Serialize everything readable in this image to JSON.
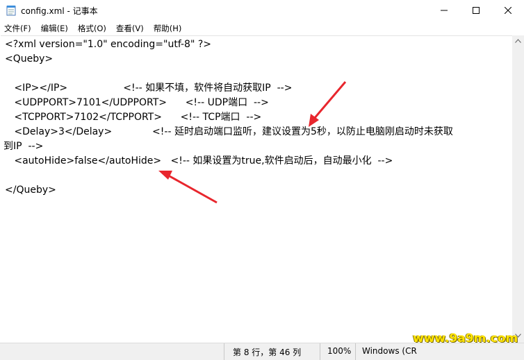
{
  "window": {
    "title": "config.xml - 记事本",
    "minimize_glyph": "minimize",
    "maximize_glyph": "maximize",
    "close_glyph": "close"
  },
  "menu": [
    "文件(F)",
    "编辑(E)",
    "格式(O)",
    "查看(V)",
    "帮助(H)"
  ],
  "editor": {
    "lines": [
      "<?xml version=\"1.0\" encoding=\"utf-8\" ?>",
      "<Queby>",
      "",
      "   <IP></IP>                  <!-- 如果不填，软件将自动获取IP  -->",
      "   <UDPPORT>7101</UDPPORT>      <!-- UDP端口  -->",
      "   <TCPPORT>7102</TCPPORT>      <!-- TCP端口  -->",
      "   <Delay>3</Delay>             <!-- 延时启动端口监听，建议设置为5秒，以防止电脑刚启动时未获取",
      "到IP  -->",
      "   <autoHide>false</autoHide>   <!-- 如果设置为true,软件启动后，自动最小化  -->",
      "",
      "</Queby>"
    ]
  },
  "status": {
    "position": "第 8 行，第 46 列",
    "zoom": "100%",
    "line_ending": "Windows (CR"
  },
  "watermark": "www.9a9m.com",
  "colors": {
    "arrow": "#e8262d",
    "watermark": "#ffe400"
  }
}
